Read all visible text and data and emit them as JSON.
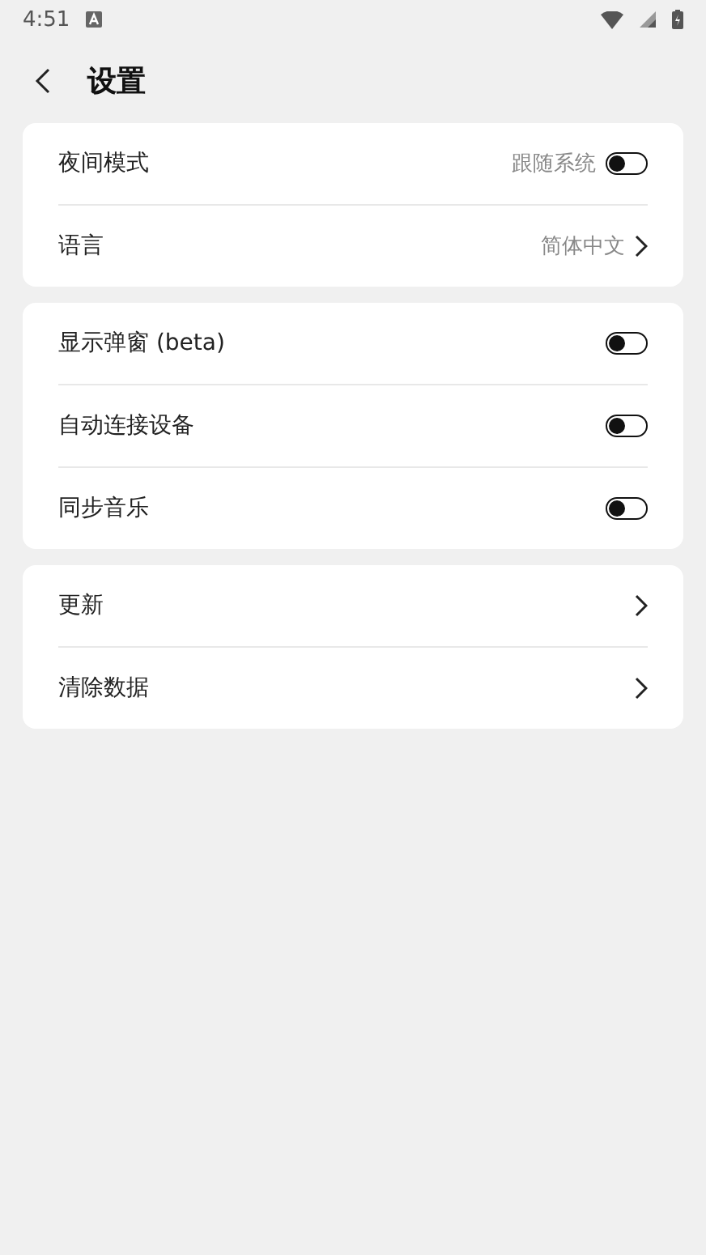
{
  "status_bar": {
    "time": "4:51"
  },
  "header": {
    "title": "设置"
  },
  "groups": [
    {
      "rows": [
        {
          "kind": "switch",
          "label": "夜间模式",
          "value": "跟随系统",
          "on": false
        },
        {
          "kind": "link",
          "label": "语言",
          "value": "简体中文"
        }
      ]
    },
    {
      "rows": [
        {
          "kind": "switch",
          "label": "显示弹窗 (beta)",
          "on": false
        },
        {
          "kind": "switch",
          "label": "自动连接设备",
          "on": false
        },
        {
          "kind": "switch",
          "label": "同步音乐",
          "on": false
        }
      ]
    },
    {
      "rows": [
        {
          "kind": "link",
          "label": "更新"
        },
        {
          "kind": "link",
          "label": "清除数据"
        }
      ]
    }
  ]
}
